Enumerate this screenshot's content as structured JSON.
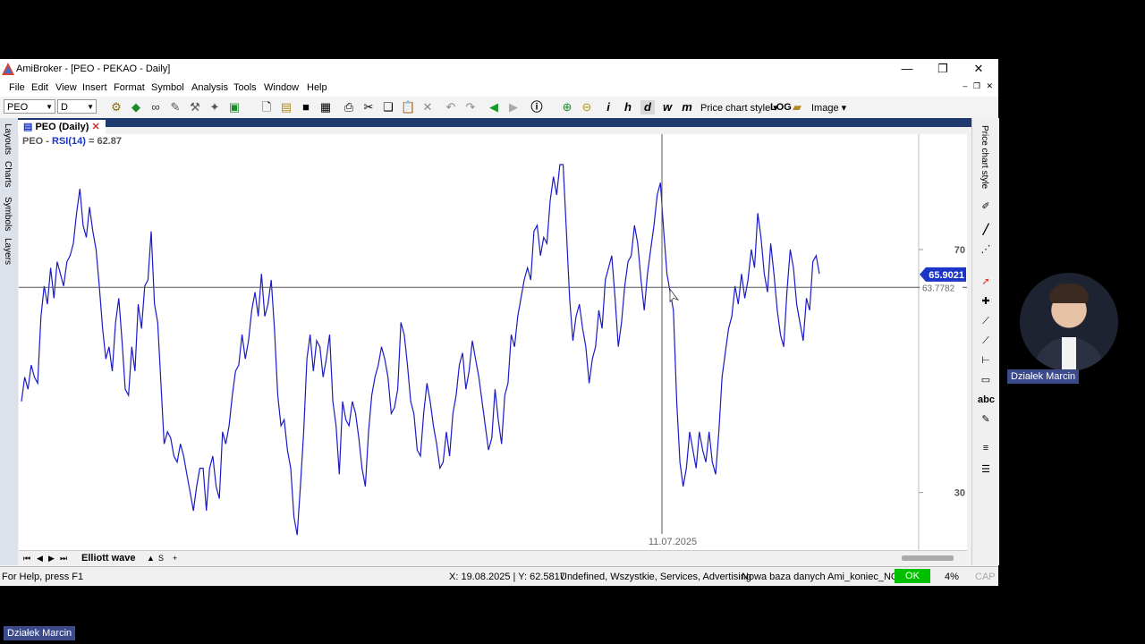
{
  "window": {
    "title": "AmiBroker - [PEO - PEKAO - Daily]",
    "controls": [
      "—",
      "❐",
      "✕"
    ]
  },
  "menu": [
    "File",
    "Edit",
    "View",
    "Insert",
    "Format",
    "Symbol",
    "Analysis",
    "Tools",
    "Window",
    "Help"
  ],
  "toolbar": {
    "symbol_value": "PEO",
    "interval_value": "D",
    "price_chart_style": "Price chart style",
    "log_label": "LOG",
    "image_label": "Image",
    "period_buttons": [
      "i",
      "h",
      "d",
      "w",
      "m"
    ]
  },
  "left_tabs": [
    "Layouts",
    "Charts",
    "Symbols",
    "Layers"
  ],
  "chart": {
    "tab_label": "PEO (Daily)",
    "symbol": "PEO",
    "indicator": "RSI(14)",
    "indicator_value": "= 62.87",
    "last_value_badge": "65.9021",
    "crosshair_value": "63.7782",
    "crosshair_date": "11.07.2025",
    "line_color": "#1a1ac8",
    "badge_color": "#1a35c8"
  },
  "chart_data": {
    "type": "line",
    "title": "",
    "xlabel": "",
    "ylabel": "",
    "ylim": [
      22,
      89
    ],
    "y_ticks": [
      30,
      70
    ],
    "y_tick_labels": [
      "70",
      "30"
    ],
    "series": [
      {
        "values": [
          45,
          49,
          47,
          51,
          49,
          48,
          59,
          64,
          61,
          67,
          62,
          68,
          66,
          64,
          68,
          69,
          71,
          76,
          80,
          74,
          72,
          77,
          73,
          70,
          64,
          57,
          52,
          54,
          50,
          58,
          62,
          55,
          47,
          46,
          54,
          50,
          61,
          57,
          64,
          65,
          73,
          61,
          58,
          48,
          38,
          40,
          39,
          36,
          35,
          38,
          36,
          33,
          30,
          27,
          31,
          34,
          34,
          27,
          34,
          36,
          31,
          29,
          40,
          38,
          41,
          46,
          50,
          51,
          56,
          52,
          55,
          60,
          63,
          59,
          66,
          59,
          61,
          65,
          57,
          46,
          41,
          42,
          37,
          34,
          26,
          23,
          31,
          40,
          52,
          56,
          50,
          55,
          54,
          49,
          52,
          56,
          45,
          41,
          33,
          45,
          42,
          41,
          45,
          43,
          39,
          34,
          31,
          40,
          46,
          49,
          51,
          54,
          52,
          49,
          43,
          44,
          47,
          58,
          56,
          51,
          45,
          43,
          37,
          36,
          43,
          48,
          45,
          41,
          38,
          34,
          35,
          40,
          36,
          43,
          46,
          51,
          53,
          47,
          50,
          55,
          52,
          49,
          45,
          41,
          37,
          39,
          47,
          42,
          38,
          46,
          48,
          56,
          54,
          59,
          62,
          65,
          67,
          65,
          73,
          74,
          69,
          72,
          71,
          78,
          82,
          79,
          84,
          84,
          73,
          62,
          55,
          59,
          61,
          57,
          54,
          48,
          52,
          54,
          60,
          57,
          65,
          67,
          69,
          62,
          54,
          58,
          64,
          68,
          69,
          74,
          71,
          65,
          60,
          66,
          70,
          74,
          79,
          81,
          73,
          66,
          63,
          60,
          45,
          35,
          31,
          34,
          40,
          37,
          34,
          40,
          37,
          35,
          40,
          35,
          33,
          40,
          49,
          53,
          57,
          59,
          64,
          61,
          66,
          62,
          65,
          70,
          67,
          76,
          72,
          66,
          63,
          71,
          66,
          60,
          56,
          54,
          63,
          70,
          67,
          61,
          58,
          55,
          62,
          60,
          68,
          69,
          66
        ],
        "x_range_start_label": "",
        "color": "#1a1ac8"
      }
    ],
    "reference_lines": [
      63.7782
    ],
    "crosshair_x_label": "11.07.2025",
    "grid": false
  },
  "sheet": {
    "tab_label": "Elliott wave",
    "icons": [
      "▲",
      "S",
      "+"
    ]
  },
  "right_dock": {
    "tab_label": "Price chart style",
    "tools_label_abc": "abc"
  },
  "status": {
    "help": "For Help, press F1",
    "coords": "X: 19.08.2025 | Y: 62.5817",
    "category": "Undefined, Wszystkie, Services, Advertising",
    "database": "Nowa baza danych Ami_koniec_NOL",
    "ok": "OK",
    "percent": "4%",
    "cap": "CAP"
  },
  "presenter": {
    "name": "Działek Marcin",
    "name_bottom": "Działek Marcin"
  }
}
